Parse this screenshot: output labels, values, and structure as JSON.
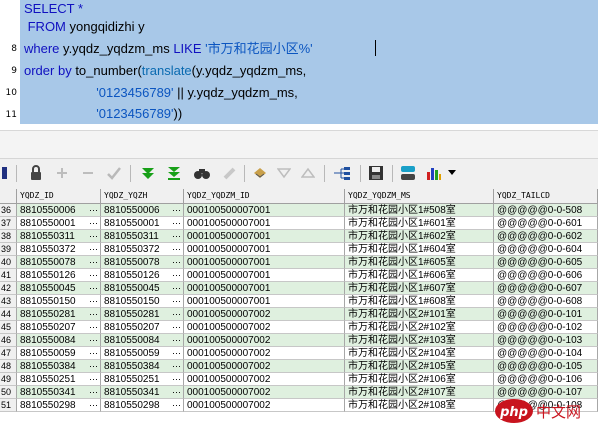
{
  "editor": {
    "line_numbers": [
      "",
      "",
      "8",
      "9",
      "10",
      "11",
      ""
    ],
    "lines": [
      [
        {
          "t": "SELECT *",
          "c": "kw"
        }
      ],
      [
        {
          "t": " FROM ",
          "c": "kw"
        },
        {
          "t": "yongqidizhi y",
          "c": "plain"
        }
      ],
      [
        {
          "t": "where ",
          "c": "kw"
        },
        {
          "t": "y.yqdz_yqdzm_ms ",
          "c": "plain"
        },
        {
          "t": "LIKE ",
          "c": "kw"
        },
        {
          "t": "'市万和花园小区%'",
          "c": "str"
        }
      ],
      [
        {
          "t": "order by ",
          "c": "kw"
        },
        {
          "t": "to_number(",
          "c": "plain"
        },
        {
          "t": "translate",
          "c": "fn"
        },
        {
          "t": "(y.yqdz_yqdzm_ms,",
          "c": "plain"
        }
      ],
      [
        {
          "t": "                    ",
          "c": "plain"
        },
        {
          "t": "'0123456789'",
          "c": "str"
        },
        {
          "t": " || y.yqdz_yqdzm_ms,",
          "c": "plain"
        }
      ],
      [
        {
          "t": "                    ",
          "c": "plain"
        },
        {
          "t": "'0123456789'",
          "c": "str"
        },
        {
          "t": "))",
          "c": "plain"
        }
      ]
    ]
  },
  "toolbar": {
    "icons": [
      "lock-icon",
      "add-icon",
      "remove-icon",
      "confirm-icon",
      "next-record-icon",
      "last-record-icon",
      "find-icon",
      "clear-icon",
      "export-icon",
      "sort-up-icon",
      "sort-down-icon",
      "query-plan-icon",
      "save-icon",
      "connection-icon",
      "chart-icon"
    ]
  },
  "grid": {
    "columns": [
      "YQDZ_ID",
      "YQDZ_YQZH",
      "YQDZ_YQDZM_ID",
      "YQDZ_YQDZM_MS",
      "YQDZ_TAILCD"
    ],
    "rows": [
      {
        "n": "36",
        "id": "8810550006",
        "zh": "8810550006",
        "dzmid": "000100500007001",
        "ms": "市万和花园小区1#508室",
        "tail": "@@@@@0-0-508"
      },
      {
        "n": "37",
        "id": "8810550001",
        "zh": "8810550001",
        "dzmid": "000100500007001",
        "ms": "市万和花园小区1#601室",
        "tail": "@@@@@0-0-601"
      },
      {
        "n": "38",
        "id": "8810550311",
        "zh": "8810550311",
        "dzmid": "000100500007001",
        "ms": "市万和花园小区1#602室",
        "tail": "@@@@@0-0-602"
      },
      {
        "n": "39",
        "id": "8810550372",
        "zh": "8810550372",
        "dzmid": "000100500007001",
        "ms": "市万和花园小区1#604室",
        "tail": "@@@@@0-0-604"
      },
      {
        "n": "40",
        "id": "8810550078",
        "zh": "8810550078",
        "dzmid": "000100500007001",
        "ms": "市万和花园小区1#605室",
        "tail": "@@@@@0-0-605"
      },
      {
        "n": "41",
        "id": "8810550126",
        "zh": "8810550126",
        "dzmid": "000100500007001",
        "ms": "市万和花园小区1#606室",
        "tail": "@@@@@0-0-606"
      },
      {
        "n": "42",
        "id": "8810550045",
        "zh": "8810550045",
        "dzmid": "000100500007001",
        "ms": "市万和花园小区1#607室",
        "tail": "@@@@@0-0-607"
      },
      {
        "n": "43",
        "id": "8810550150",
        "zh": "8810550150",
        "dzmid": "000100500007001",
        "ms": "市万和花园小区1#608室",
        "tail": "@@@@@0-0-608"
      },
      {
        "n": "44",
        "id": "8810550281",
        "zh": "8810550281",
        "dzmid": "000100500007002",
        "ms": "市万和花园小区2#101室",
        "tail": "@@@@@0-0-101"
      },
      {
        "n": "45",
        "id": "8810550207",
        "zh": "8810550207",
        "dzmid": "000100500007002",
        "ms": "市万和花园小区2#102室",
        "tail": "@@@@@0-0-102"
      },
      {
        "n": "46",
        "id": "8810550084",
        "zh": "8810550084",
        "dzmid": "000100500007002",
        "ms": "市万和花园小区2#103室",
        "tail": "@@@@@0-0-103"
      },
      {
        "n": "47",
        "id": "8810550059",
        "zh": "8810550059",
        "dzmid": "000100500007002",
        "ms": "市万和花园小区2#104室",
        "tail": "@@@@@0-0-104"
      },
      {
        "n": "48",
        "id": "8810550384",
        "zh": "8810550384",
        "dzmid": "000100500007002",
        "ms": "市万和花园小区2#105室",
        "tail": "@@@@@0-0-105"
      },
      {
        "n": "49",
        "id": "8810550251",
        "zh": "8810550251",
        "dzmid": "000100500007002",
        "ms": "市万和花园小区2#106室",
        "tail": "@@@@@0-0-106"
      },
      {
        "n": "50",
        "id": "8810550341",
        "zh": "8810550341",
        "dzmid": "000100500007002",
        "ms": "市万和花园小区2#107室",
        "tail": "@@@@@0-0-107"
      },
      {
        "n": "51",
        "id": "8810550298",
        "zh": "8810550298",
        "dzmid": "000100500007002",
        "ms": "市万和花园小区2#108室",
        "tail": "@@@@@0-0-108"
      }
    ],
    "ellipsis": "⋯"
  },
  "watermark": {
    "brand": "php",
    "text": "中文网"
  }
}
